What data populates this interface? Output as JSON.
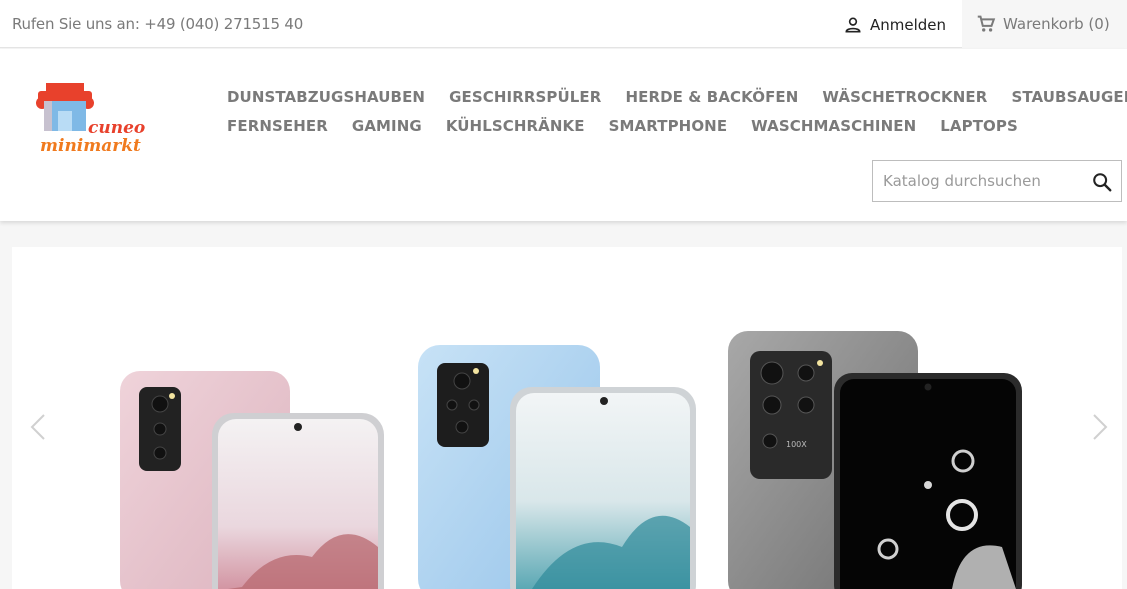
{
  "topbar": {
    "contact": "Rufen Sie uns an: +49 (040) 271515 40",
    "login_label": "Anmelden",
    "cart_label": "Warenkorb (0)"
  },
  "logo": {
    "line1": "cuneo",
    "line2": "minimarkt"
  },
  "nav": {
    "row1": [
      "DUNSTABZUGSHAUBEN",
      "GESCHIRRSPÜLER",
      "HERDE & BACKÖFEN",
      "WÄSCHETROCKNER",
      "STAUBSAUGER"
    ],
    "row2": [
      "FERNSEHER",
      "GAMING",
      "KÜHLSCHRÄNKE",
      "SMARTPHONE",
      "WASCHMASCHINEN",
      "LAPTOPS"
    ]
  },
  "search": {
    "placeholder": "Katalog durchsuchen",
    "value": ""
  },
  "slider": {
    "camera_badge": "100X"
  },
  "icons": {
    "login": "user-icon",
    "cart": "shopping-cart-icon",
    "search": "search-icon",
    "prev": "chevron-left-icon",
    "next": "chevron-right-icon"
  },
  "colors": {
    "nav_text": "#7a7a7a",
    "logo_red": "#e8412c",
    "logo_orange": "#f39c12",
    "phone_pink": "#e8c6cf",
    "phone_blue": "#a9d0ef",
    "phone_gray": "#8c8c8c"
  }
}
